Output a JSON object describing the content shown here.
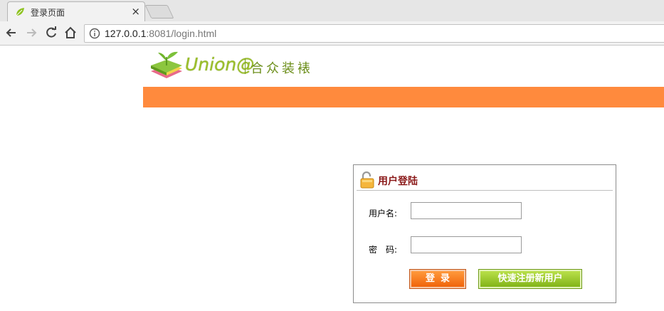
{
  "browser": {
    "tab_title": "登录页面",
    "tab_close": "×",
    "url_host": "127.0.0.1",
    "url_rest": ":8081/login.html"
  },
  "logo": {
    "text_en": "Union@",
    "text_cn": "合众装裱"
  },
  "login": {
    "title": "用户登陆",
    "username_label": "用户名:",
    "password_label": "密　码:",
    "username_value": "",
    "password_value": "",
    "login_button": "登录",
    "register_button": "快速注册新用户"
  },
  "colors": {
    "orange_bar": "#ff8a3d",
    "title_red": "#8b1a1a",
    "login_btn": "#f0640a",
    "register_btn": "#82b418"
  }
}
